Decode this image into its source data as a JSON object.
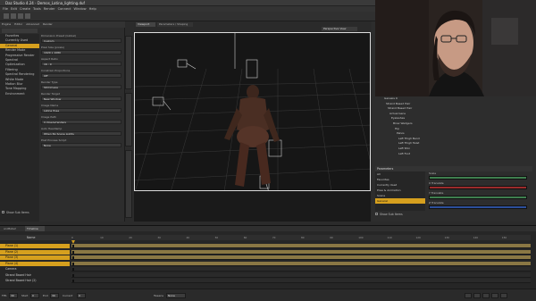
{
  "window": {
    "title": "Daz Studio 4.24 - Demos_Latina_lighting.duf"
  },
  "menu": [
    "File",
    "Edit",
    "Create",
    "Tools",
    "Render",
    "Connect",
    "Window",
    "Help"
  ],
  "left_panel": {
    "tabs": [
      "Engine",
      "Editor",
      "Advanced",
      "Render"
    ],
    "categories": [
      "Favorites",
      "Currently Used",
      "General",
      "Render Mode",
      "Progressive Render",
      "Spectral",
      "Optimization",
      "Filtering",
      "Spectral Rendering",
      "White Mode",
      "Motion Blur",
      "Tone Mapping",
      "Environment"
    ],
    "selected_category": "General",
    "properties": [
      {
        "label": "Dimension Preset (Global)",
        "value": "Custom"
      },
      {
        "label": "Pixel Size (pixels)",
        "value": "1920 x 1080"
      },
      {
        "label": "Aspect Ratio",
        "value": "16 : 9"
      },
      {
        "label": "Constrain Proportions",
        "value": "Off"
      },
      {
        "label": "Render Type",
        "value": "Still Image"
      },
      {
        "label": "Render Target",
        "value": "New Window"
      },
      {
        "label": "Image Name",
        "value": "Latina Pose"
      },
      {
        "label": "Image Path",
        "value": "C:/Users/renders"
      },
      {
        "label": "Auto Headlamp",
        "value": "When No Scene Lights"
      },
      {
        "label": "Post Process Script",
        "value": "None"
      }
    ],
    "show_sub_items": "Show Sub Items"
  },
  "viewport": {
    "tabs": [
      "Viewport",
      "Parameters / Shaping"
    ],
    "camera": "Perspective View"
  },
  "right_panel": {
    "scene_items": [
      "Genesis 9",
      "Strand Based Hair",
      "Strand Based Hair",
      "Actual Gens",
      "Eyelashes",
      "Brow Wedgers",
      "Hip",
      "Pelvis",
      "Left Thigh Bend",
      "Left Thigh Twist",
      "Left Shin",
      "Left Foot"
    ],
    "lower_section_title": "Parameters",
    "lower_categories": [
      "All",
      "Favorites",
      "Currently Used",
      "Pose & Animation",
      "Scene",
      "General"
    ],
    "parameter_rows": [
      {
        "label": "Scale",
        "color": "#3f7f4f"
      },
      {
        "label": "X Translate",
        "color": "#9a2c2c"
      },
      {
        "label": "Y Translate",
        "color": "#3f7f4f"
      },
      {
        "label": "Z Translate",
        "color": "#2c4f9a"
      }
    ],
    "show_sub_items": "Show Sub Items"
  },
  "timeline": {
    "tabs": [
      "Timeline",
      "aniMate2"
    ],
    "column_header": "Name",
    "tracks": [
      {
        "label": "Plane (1)",
        "selected": true
      },
      {
        "label": "Plane (2)",
        "selected": true
      },
      {
        "label": "Plane (3)",
        "selected": true
      },
      {
        "label": "Plane (4)",
        "selected": true
      },
      {
        "label": "Camera",
        "selected": false
      },
      {
        "label": "Strand Based Hair",
        "selected": false
      },
      {
        "label": "Strand Based Hair (2)",
        "selected": false
      }
    ],
    "ruler_labels": [
      "0",
      "10",
      "20",
      "30",
      "40",
      "50",
      "60",
      "70",
      "80",
      "90",
      "100",
      "110",
      "120",
      "130",
      "140",
      "150"
    ],
    "footer": {
      "fps_label": "FPS",
      "fps_value": "30",
      "start_label": "Start",
      "start_value": "0",
      "end_label": "End",
      "end_value": "30",
      "current_label": "Current",
      "current_value": "0",
      "tweens_label": "Tweens",
      "tweens_value": "None"
    }
  },
  "colors": {
    "accent": "#d6a01e",
    "viewport_bg": "#161616",
    "panel_bg": "#2d2d2d"
  }
}
